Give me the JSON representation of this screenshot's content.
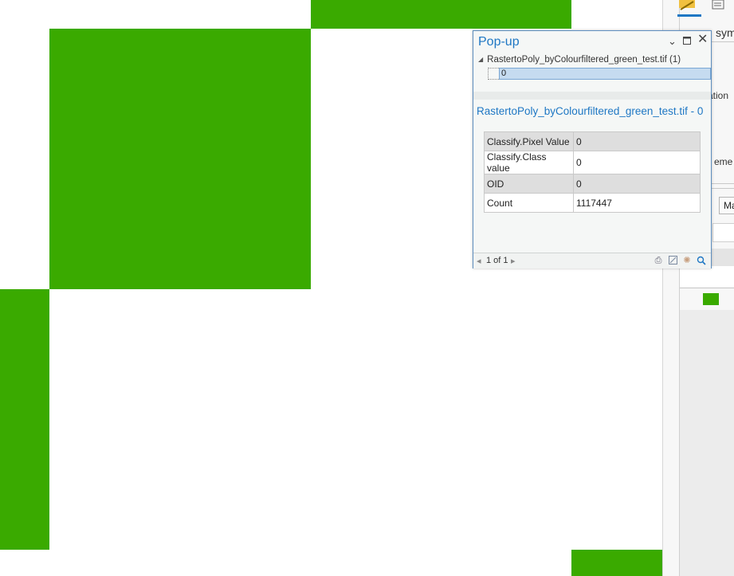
{
  "map": {
    "fill_color": "#3aaa00",
    "background_color": "#ffffff"
  },
  "popup": {
    "title": "Pop-up",
    "controls": {
      "menu_icon": "chevron-down-icon",
      "restore_icon": "maximize-icon",
      "close_icon": "close-icon"
    },
    "tree": {
      "layer_label": "RastertoPoly_byColourfiltered_green_test.tif (1)",
      "selected_item": "0"
    },
    "feature_title": "RastertoPoly_byColourfiltered_green_test.tif - 0",
    "attributes": [
      {
        "field": "Classify.Pixel Value",
        "value": "0"
      },
      {
        "field": "Classify.Class value",
        "value": "0"
      },
      {
        "field": "OID",
        "value": "0"
      },
      {
        "field": "Count",
        "value": "1117447"
      }
    ],
    "footer": {
      "page_indicator": "1 of 1",
      "tools": [
        "print-icon",
        "export-icon",
        "flash-icon",
        "zoom-to-icon"
      ]
    }
  },
  "symbology_pane": {
    "fragments": {
      "top_label": "sym",
      "label_ation": "ation",
      "label_eme": "eme",
      "tab_label": "Ma"
    },
    "swatch_color": "#3aaa00"
  }
}
